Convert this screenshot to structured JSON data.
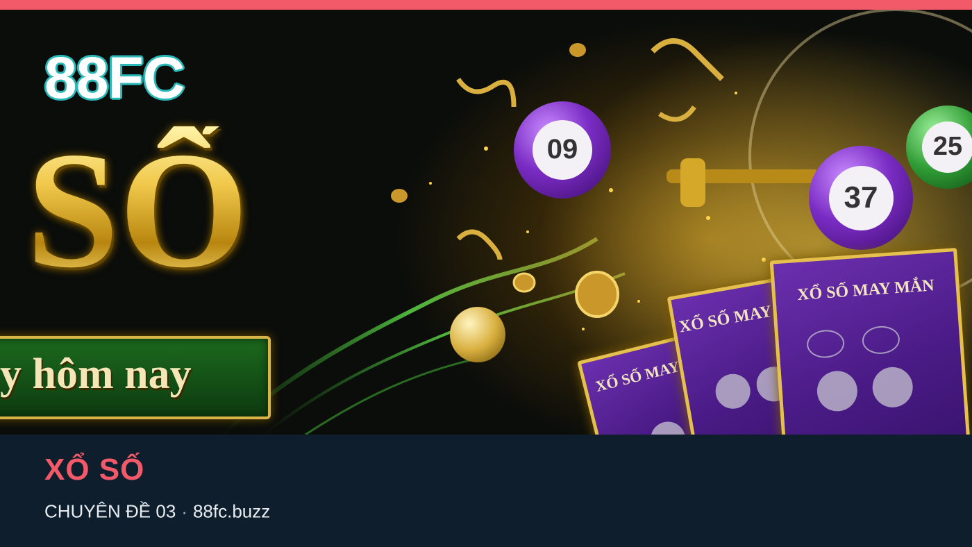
{
  "hero": {
    "brand_logo": "88FC",
    "headline": "SỐ",
    "plate_text": "y hôm nay",
    "balls": [
      {
        "number": "09",
        "color": "purple"
      },
      {
        "number": "37",
        "color": "purple"
      },
      {
        "number": "25",
        "color": "green"
      }
    ],
    "tickets": [
      {
        "title": "XỔ SỐ MAY MẮN"
      },
      {
        "title": "XỔ SỐ MAY MẮ"
      },
      {
        "title": "XỔ SỐ MAY MA"
      }
    ]
  },
  "caption": {
    "title": "XỔ SỐ",
    "series_label": "CHUYÊN ĐỀ 03",
    "separator": "·",
    "site": "88fc.buzz"
  },
  "colors": {
    "accent": "#f25a6a",
    "caption_bg": "#0f1e2c",
    "logo_outline": "#2bb8b8",
    "gold": "#e9c54a"
  }
}
